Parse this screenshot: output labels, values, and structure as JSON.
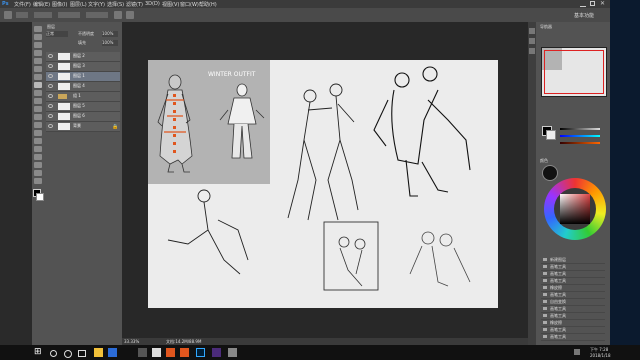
{
  "menubar": {
    "items": [
      "文件(F)",
      "编辑(E)",
      "图像(I)",
      "图层(L)",
      "文字(Y)",
      "选择(S)",
      "滤镜(T)",
      "3D(D)",
      "视图(V)",
      "窗口(W)",
      "帮助(H)"
    ]
  },
  "optbar": {
    "workspace_label": "基本功能"
  },
  "layers_panel": {
    "tab": "图层",
    "mode": "正常",
    "opacity_label": "不透明度",
    "opacity": "100%",
    "fill_label": "填充",
    "fill": "100%",
    "items": [
      {
        "name": "图层 2"
      },
      {
        "name": "图层 3"
      },
      {
        "name": "图层 1"
      },
      {
        "name": "图层 4"
      },
      {
        "name": "组 1"
      },
      {
        "name": "图层 5"
      },
      {
        "name": "图层 6"
      },
      {
        "name": "背景"
      }
    ]
  },
  "canvas": {
    "panel_text": "WINTER OUTFIT"
  },
  "statusbar": {
    "zoom": "33.33%",
    "doc": "文档:14.2M/88.9M"
  },
  "right_panel": {
    "navigator_tab": "导航器",
    "color_tab": "颜色",
    "history_items": [
      "新建图层",
      "画笔工具",
      "画笔工具",
      "画笔工具",
      "橡皮擦",
      "画笔工具",
      "自由变换",
      "画笔工具",
      "画笔工具",
      "橡皮擦",
      "画笔工具",
      "画笔工具"
    ]
  },
  "taskbar": {
    "time": "下午 7:28",
    "date": "2018/1/18"
  },
  "colors": {
    "accent": "#2b6cd8",
    "orange": "#e0561e"
  }
}
